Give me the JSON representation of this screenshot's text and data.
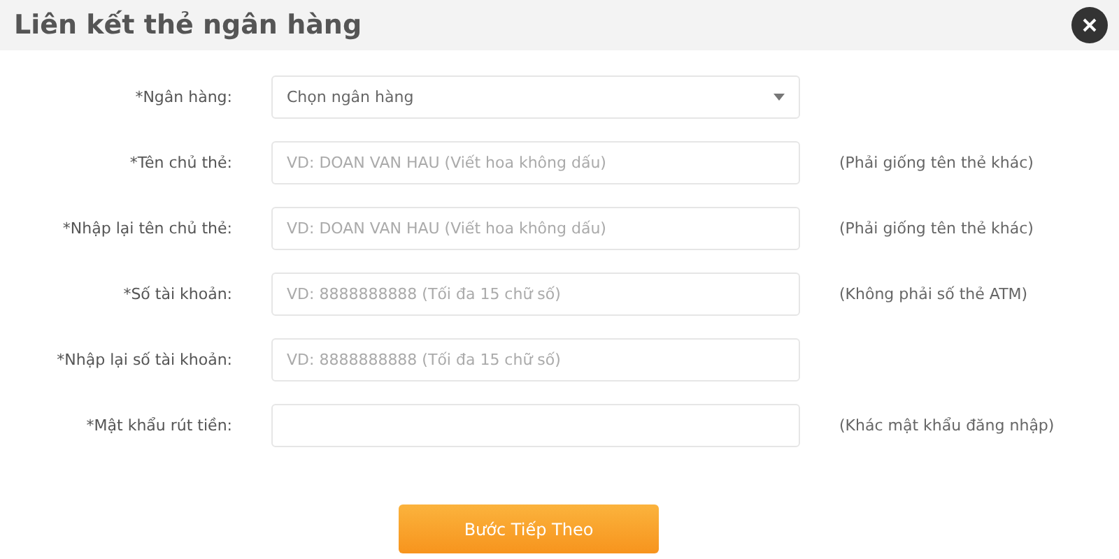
{
  "dialog": {
    "title": "Liên kết thẻ ngân hàng"
  },
  "fields": [
    {
      "kind": "select",
      "label": "*Ngân hàng:",
      "value": "Chọn ngân hàng"
    },
    {
      "kind": "text",
      "label": "*Tên chủ thẻ:",
      "placeholder": "VD: DOAN VAN HAU (Viết hoa không dấu)",
      "note": "(Phải giống tên thẻ khác)"
    },
    {
      "kind": "text",
      "label": "*Nhập lại tên chủ thẻ:",
      "placeholder": "VD: DOAN VAN HAU (Viết hoa không dấu)",
      "note": "(Phải giống tên thẻ khác)"
    },
    {
      "kind": "text",
      "label": "*Số tài khoản:",
      "placeholder": "VD: 8888888888 (Tối đa 15 chữ số)",
      "note": "(Không phải số thẻ ATM)"
    },
    {
      "kind": "text",
      "label": "*Nhập lại số tài khoản:",
      "placeholder": "VD: 8888888888 (Tối đa 15 chữ số)"
    },
    {
      "kind": "password",
      "label": "*Mật khẩu rút tiền:",
      "note": "(Khác mật khẩu đăng nhập)"
    }
  ],
  "submit": {
    "label": "Bước Tiếp Theo"
  }
}
